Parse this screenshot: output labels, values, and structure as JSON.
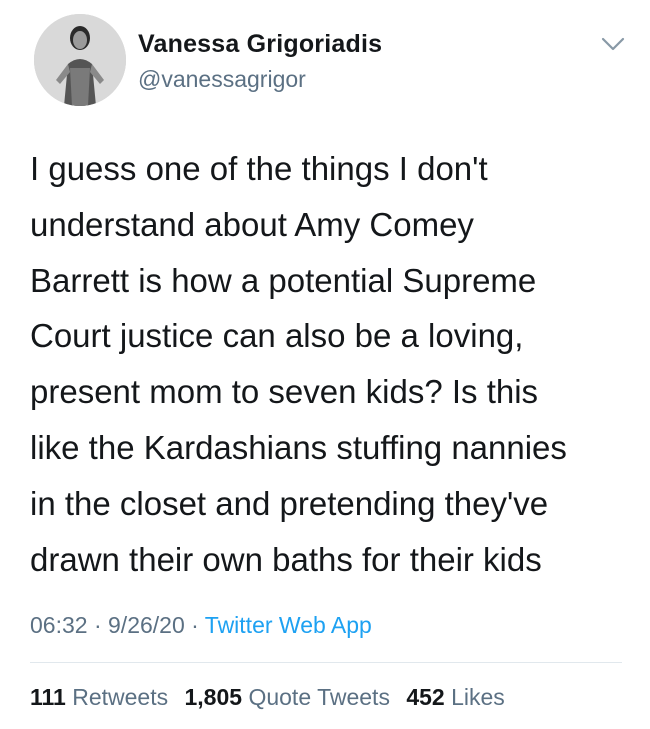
{
  "author": {
    "display_name": "Vanessa Grigoriadis",
    "handle": "@vanessagrigor",
    "avatar_icon": "profile-photo"
  },
  "menu_icon": "chevron-down-icon",
  "tweet": {
    "text": "I guess one of the things I don't\nunderstand about Amy Comey\nBarrett is how a potential Supreme\nCourt justice can also be a loving,\npresent mom to seven kids? Is this\nlike the Kardashians stuffing nannies\nin the closet and pretending they've\ndrawn their own baths for their kids",
    "time": "06:32",
    "date": "9/26/20",
    "source": "Twitter Web App",
    "separator": " · "
  },
  "stats": {
    "retweets_count": "111",
    "retweets_label": "Retweets",
    "quote_count": "1,805",
    "quote_label": "Quote Tweets",
    "likes_count": "452",
    "likes_label": "Likes"
  },
  "colors": {
    "text": "#14171a",
    "secondary": "#5b7083",
    "link": "#1da1f2",
    "divider": "#e1e8ed"
  }
}
